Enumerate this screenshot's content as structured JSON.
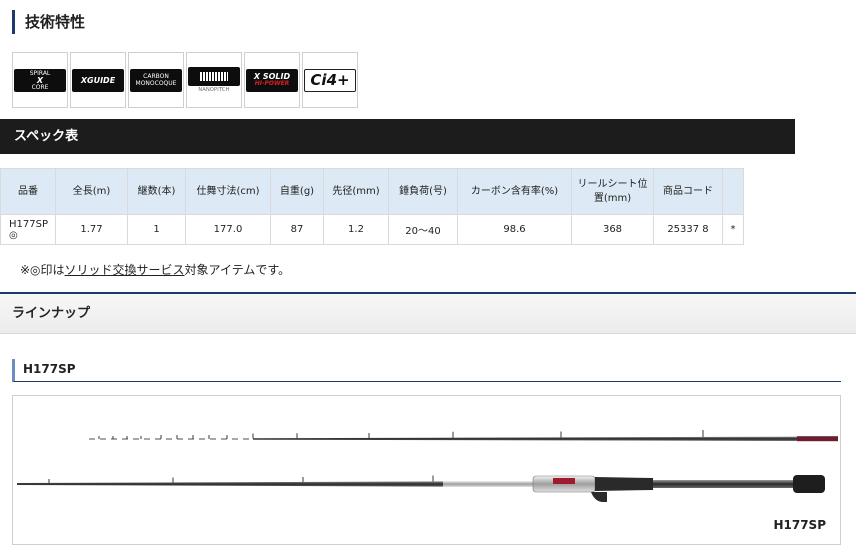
{
  "tech": {
    "heading": "技術特性",
    "logos": [
      {
        "name": "spiral-x-core-logo",
        "lines": [
          "SPIRAL",
          "X",
          "CORE"
        ]
      },
      {
        "name": "x-guide-logo",
        "lines": [
          "XGUIDE"
        ]
      },
      {
        "name": "carbon-monocoque-logo",
        "lines": [
          "CARBON",
          "MONOCOQUE"
        ]
      },
      {
        "name": "nanopitch-logo",
        "lines": [
          "NANOPITCH"
        ]
      },
      {
        "name": "x-solid-hi-power-logo",
        "lines": [
          "X SOLID",
          "HI-POWER"
        ]
      },
      {
        "name": "ci4-plus-logo",
        "lines": [
          "Ci4+"
        ]
      }
    ]
  },
  "spec": {
    "title": "スペック表",
    "headers": [
      "品番",
      "全長(m)",
      "継数(本)",
      "仕舞寸法(cm)",
      "自重(g)",
      "先径(mm)",
      "錘負荷(号)",
      "カーボン含有率(%)",
      "リールシート位置(mm)",
      "商品コード",
      ""
    ],
    "row": [
      "H177SP ◎",
      "1.77",
      "1",
      "177.0",
      "87",
      "1.2",
      "20〜40",
      "98.6",
      "368",
      "25337 8",
      "*"
    ],
    "note_prefix": "※◎印は",
    "note_link": "ソリッド交換サービス",
    "note_suffix": "対象アイテムです。"
  },
  "lineup": {
    "title": "ラインナップ",
    "model": "H177SP",
    "rod_label": "H177SP"
  }
}
